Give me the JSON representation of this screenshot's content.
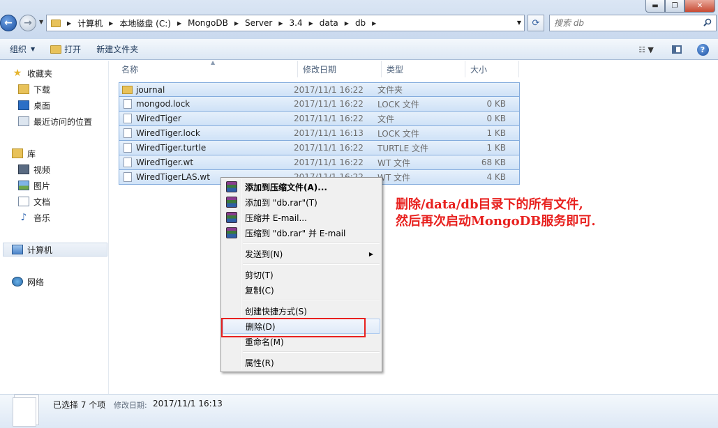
{
  "window": {
    "min_glyph": "▬",
    "max_glyph": "❐",
    "close_glyph": "✕"
  },
  "address": {
    "crumbs": [
      "计算机",
      "本地磁盘 (C:)",
      "MongoDB",
      "Server",
      "3.4",
      "data",
      "db"
    ],
    "search_placeholder": "搜索 db"
  },
  "toolbar": {
    "organize": "组织",
    "open": "打开",
    "new_folder": "新建文件夹"
  },
  "sidebar": {
    "favorites": "收藏夹",
    "downloads": "下载",
    "desktop": "桌面",
    "recent": "最近访问的位置",
    "libraries": "库",
    "videos": "视频",
    "pictures": "图片",
    "documents": "文档",
    "music": "音乐",
    "computer": "计算机",
    "network": "网络"
  },
  "columns": {
    "name": "名称",
    "modified": "修改日期",
    "type": "类型",
    "size": "大小"
  },
  "files": [
    {
      "name": "journal",
      "date": "2017/11/1 16:22",
      "type": "文件夹",
      "size": "",
      "kind": "folder"
    },
    {
      "name": "mongod.lock",
      "date": "2017/11/1 16:22",
      "type": "LOCK 文件",
      "size": "0 KB",
      "kind": "file"
    },
    {
      "name": "WiredTiger",
      "date": "2017/11/1 16:22",
      "type": "文件",
      "size": "0 KB",
      "kind": "file"
    },
    {
      "name": "WiredTiger.lock",
      "date": "2017/11/1 16:13",
      "type": "LOCK 文件",
      "size": "1 KB",
      "kind": "file"
    },
    {
      "name": "WiredTiger.turtle",
      "date": "2017/11/1 16:22",
      "type": "TURTLE 文件",
      "size": "1 KB",
      "kind": "file"
    },
    {
      "name": "WiredTiger.wt",
      "date": "2017/11/1 16:22",
      "type": "WT 文件",
      "size": "68 KB",
      "kind": "file"
    },
    {
      "name": "WiredTigerLAS.wt",
      "date": "2017/11/1 16:22",
      "type": "WT 文件",
      "size": "4 KB",
      "kind": "file"
    }
  ],
  "context_menu": {
    "add_archive": "添加到压缩文件(A)...",
    "add_rar": "添加到 \"db.rar\"(T)",
    "compress_email": "压缩并 E-mail...",
    "compress_rar_email": "压缩到 \"db.rar\" 并 E-mail",
    "send_to": "发送到(N)",
    "cut": "剪切(T)",
    "copy": "复制(C)",
    "shortcut": "创建快捷方式(S)",
    "delete": "删除(D)",
    "rename": "重命名(M)",
    "properties": "属性(R)"
  },
  "annotation": {
    "line1": "删除/data/db目录下的所有文件,",
    "line2": "然后再次启动MongoDB服务即可."
  },
  "status": {
    "selected": "已选择 7 个项",
    "modified_label": "修改日期:",
    "modified_value": "2017/11/1 16:13"
  },
  "colors": {
    "highlight_border": "#e8211f",
    "selection": "#cfe2f7"
  }
}
